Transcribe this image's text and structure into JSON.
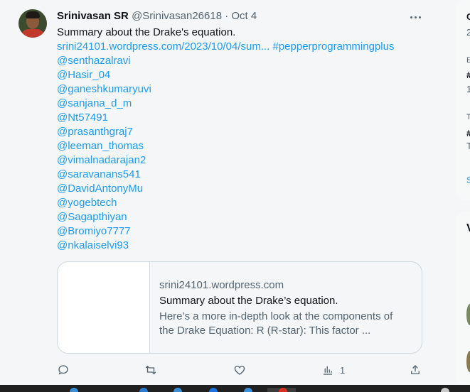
{
  "tweet": {
    "author_name": "Srinivasan SR",
    "author_handle": "@Srinivasan26618",
    "separator": "·",
    "date": "Oct 4",
    "text": "Summary about the Drake's equation.",
    "link_text": "srini24101.wordpress.com/2023/10/04/sum...",
    "hashtag": "#pepperprogrammingplus",
    "mentions": [
      "@senthazalravi",
      "@Hasir_04",
      "@ganeshkumaryuvi",
      "@sanjana_d_m",
      "@Nt57491",
      "@prasanthgraj7",
      "@leeman_thomas",
      "@vimalnadarajan2",
      "@saravanans541",
      "@DavidAntonyMu",
      "@yogebtech",
      "@Sagapthiyan",
      "@Bromiyo7777",
      "@nkalaiselvi93"
    ],
    "card": {
      "domain": "srini24101.wordpress.com",
      "title": "Summary about the Drake’s equation.",
      "description_line1": "Here’s a more in-depth look at the components of",
      "description_line2": "the Drake Equation: R (R-star): This factor ..."
    },
    "actions": {
      "reply_icon": "reply-icon",
      "retweet_icon": "retweet-icon",
      "like_icon": "heart-icon",
      "views_icon": "views-icon",
      "views_count": "1",
      "share_icon": "share-icon"
    }
  },
  "right_panel": {
    "glyphs": [
      "C",
      "2",
      "E",
      "#",
      "1",
      "T",
      "#",
      "T",
      "S",
      "V"
    ]
  },
  "colors": {
    "link": "#1d9bf0",
    "secondary_text": "#536471",
    "primary_text": "#0f1419",
    "background": "#f5f6f7",
    "border": "#cfd9de"
  }
}
